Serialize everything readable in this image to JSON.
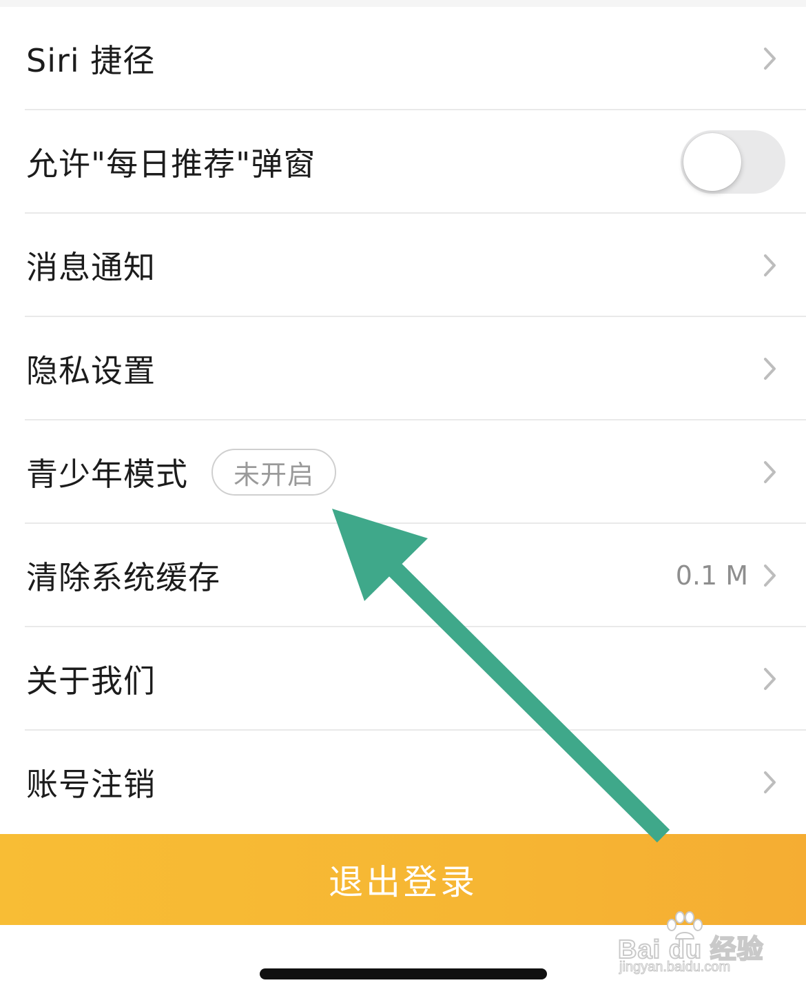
{
  "settings": {
    "items": [
      {
        "label": "Siri 捷径",
        "control": "chevron"
      },
      {
        "label": "允许\"每日推荐\"弹窗",
        "control": "toggle",
        "toggle_on": false
      },
      {
        "label": "消息通知",
        "control": "chevron"
      },
      {
        "label": "隐私设置",
        "control": "chevron"
      },
      {
        "label": "青少年模式",
        "control": "chevron",
        "badge": "未开启"
      },
      {
        "label": "清除系统缓存",
        "control": "chevron",
        "value": "0.1 M"
      },
      {
        "label": "关于我们",
        "control": "chevron"
      },
      {
        "label": "账号注销",
        "control": "chevron"
      }
    ]
  },
  "logout": {
    "label": "退出登录"
  },
  "watermark": {
    "brand": "Bai du 经验",
    "url": "jingyan.baidu.com"
  },
  "icons": {
    "row_arrow": "chevron-right-icon",
    "annotation": "arrow-pointer-icon",
    "watermark": "baidu-paw-icon"
  },
  "colors": {
    "accent": "#f6b633",
    "annotation_arrow": "#3fa88a",
    "separator": "#e9e9e9",
    "secondary_text": "#8e8e8e",
    "chevron": "#bdbdbd"
  }
}
